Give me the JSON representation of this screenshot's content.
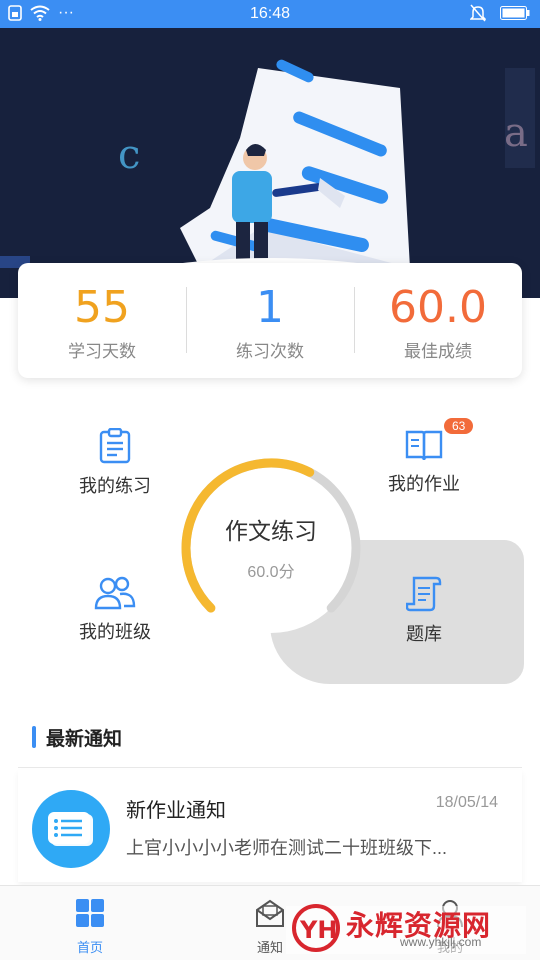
{
  "status_bar": {
    "time": "16:48",
    "dots": "···"
  },
  "stats": [
    {
      "value": "55",
      "label": "学习天数",
      "color": "#f0a21f"
    },
    {
      "value": "1",
      "label": "练习次数",
      "color": "#3b8ef3"
    },
    {
      "value": "60.0",
      "label": "最佳成绩",
      "color": "#f26b3a"
    }
  ],
  "menu": {
    "practice": "我的练习",
    "homework": "我的作业",
    "homework_badge": "63",
    "class": "我的班级",
    "question_bank": "题库"
  },
  "center": {
    "title": "作文练习",
    "score": "60.0分",
    "progress": 0.6,
    "accent": "#f5b830",
    "track": "#d5d5d5"
  },
  "notice": {
    "section_title": "最新通知",
    "item": {
      "title": "新作业通知",
      "date": "18/05/14",
      "body": "上官小小小小老师在测试二十班班级下..."
    }
  },
  "nav": {
    "home": "首页",
    "notify": "通知",
    "mine": "我的"
  },
  "watermark": {
    "text": "永辉资源网",
    "url_text": "www.yhkjlj.com",
    "logo": "YH"
  },
  "colors": {
    "accent": "#3b8ef3",
    "hero": "#17213d"
  }
}
